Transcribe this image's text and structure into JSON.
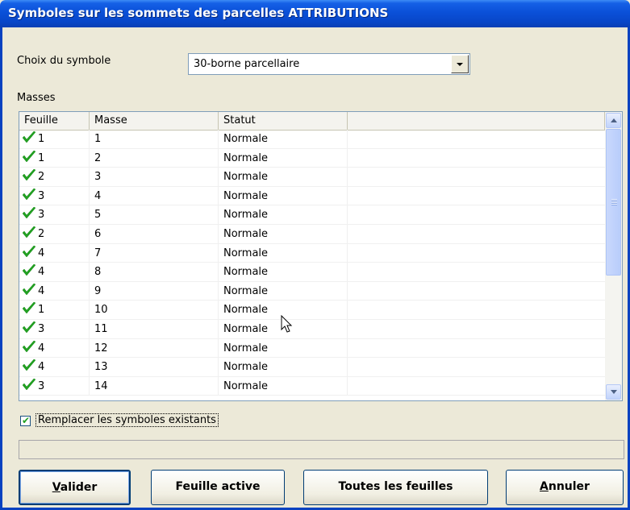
{
  "window": {
    "title": "Symboles sur les sommets des parcelles ATTRIBUTIONS"
  },
  "symbol_choice": {
    "label": "Choix du symbole",
    "selected": "30-borne parcellaire"
  },
  "masses": {
    "label": "Masses",
    "columns": [
      "Feuille",
      "Masse",
      "Statut",
      ""
    ],
    "rows": [
      {
        "feuille": "1",
        "masse": "1",
        "statut": "Normale"
      },
      {
        "feuille": "1",
        "masse": "2",
        "statut": "Normale"
      },
      {
        "feuille": "2",
        "masse": "3",
        "statut": "Normale"
      },
      {
        "feuille": "3",
        "masse": "4",
        "statut": "Normale"
      },
      {
        "feuille": "3",
        "masse": "5",
        "statut": "Normale"
      },
      {
        "feuille": "2",
        "masse": "6",
        "statut": "Normale"
      },
      {
        "feuille": "4",
        "masse": "7",
        "statut": "Normale"
      },
      {
        "feuille": "4",
        "masse": "8",
        "statut": "Normale"
      },
      {
        "feuille": "4",
        "masse": "9",
        "statut": "Normale"
      },
      {
        "feuille": "1",
        "masse": "10",
        "statut": "Normale"
      },
      {
        "feuille": "3",
        "masse": "11",
        "statut": "Normale"
      },
      {
        "feuille": "4",
        "masse": "12",
        "statut": "Normale"
      },
      {
        "feuille": "4",
        "masse": "13",
        "statut": "Normale"
      },
      {
        "feuille": "3",
        "masse": "14",
        "statut": "Normale"
      }
    ]
  },
  "replace_checkbox": {
    "label": "Remplacer  les symboles existants",
    "checked": true
  },
  "buttons": {
    "validate": {
      "mnemonic": "V",
      "rest": "alider"
    },
    "active_sheet": "Feuille active",
    "all_sheets": "Toutes les feuilles",
    "cancel": {
      "mnemonic": "A",
      "rest": "nnuler"
    }
  },
  "colors": {
    "title_bar": "#0a50d8",
    "check": "#21a121",
    "dialog_bg": "#ece9d8"
  }
}
